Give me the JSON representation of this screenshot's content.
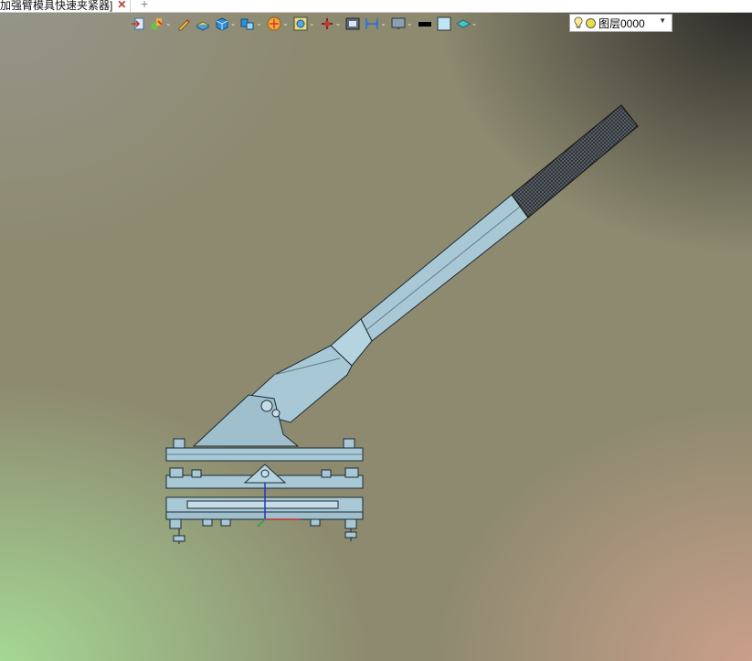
{
  "tabbar": {
    "doc_tab_label": "加强臂模具快速夹紧器]",
    "close_glyph": "✕",
    "add_glyph": "+"
  },
  "toolbar": {
    "buttons": [
      {
        "icon": "import-icon",
        "has_dropdown": false
      },
      {
        "icon": "snap-tool-icon",
        "has_dropdown": true
      },
      {
        "icon": "pencil-icon",
        "has_dropdown": false
      },
      {
        "icon": "extrude-icon",
        "has_dropdown": false
      },
      {
        "icon": "solid-box-icon",
        "has_dropdown": true
      },
      {
        "icon": "assembly-icon",
        "has_dropdown": true
      },
      {
        "icon": "render-style-icon",
        "has_dropdown": true
      },
      {
        "icon": "zoom-view-icon",
        "has_dropdown": true
      },
      {
        "icon": "pointer-tool-icon",
        "has_dropdown": true
      },
      {
        "icon": "screenshot-icon",
        "has_dropdown": false
      },
      {
        "icon": "dimension-icon",
        "has_dropdown": true
      },
      {
        "icon": "display-monitor-icon",
        "has_dropdown": true
      },
      {
        "icon": "color-black-icon",
        "has_dropdown": false
      },
      {
        "icon": "color-lightblue-icon",
        "has_dropdown": false
      },
      {
        "icon": "layer-stack-icon",
        "has_dropdown": true
      }
    ]
  },
  "layer_selector": {
    "value": "图层0000",
    "dropdown_glyph": "▼"
  },
  "colors": {
    "part_fill": "#a9c8d6",
    "part_edge": "#1b2a33",
    "grip": "#3a3f44"
  }
}
